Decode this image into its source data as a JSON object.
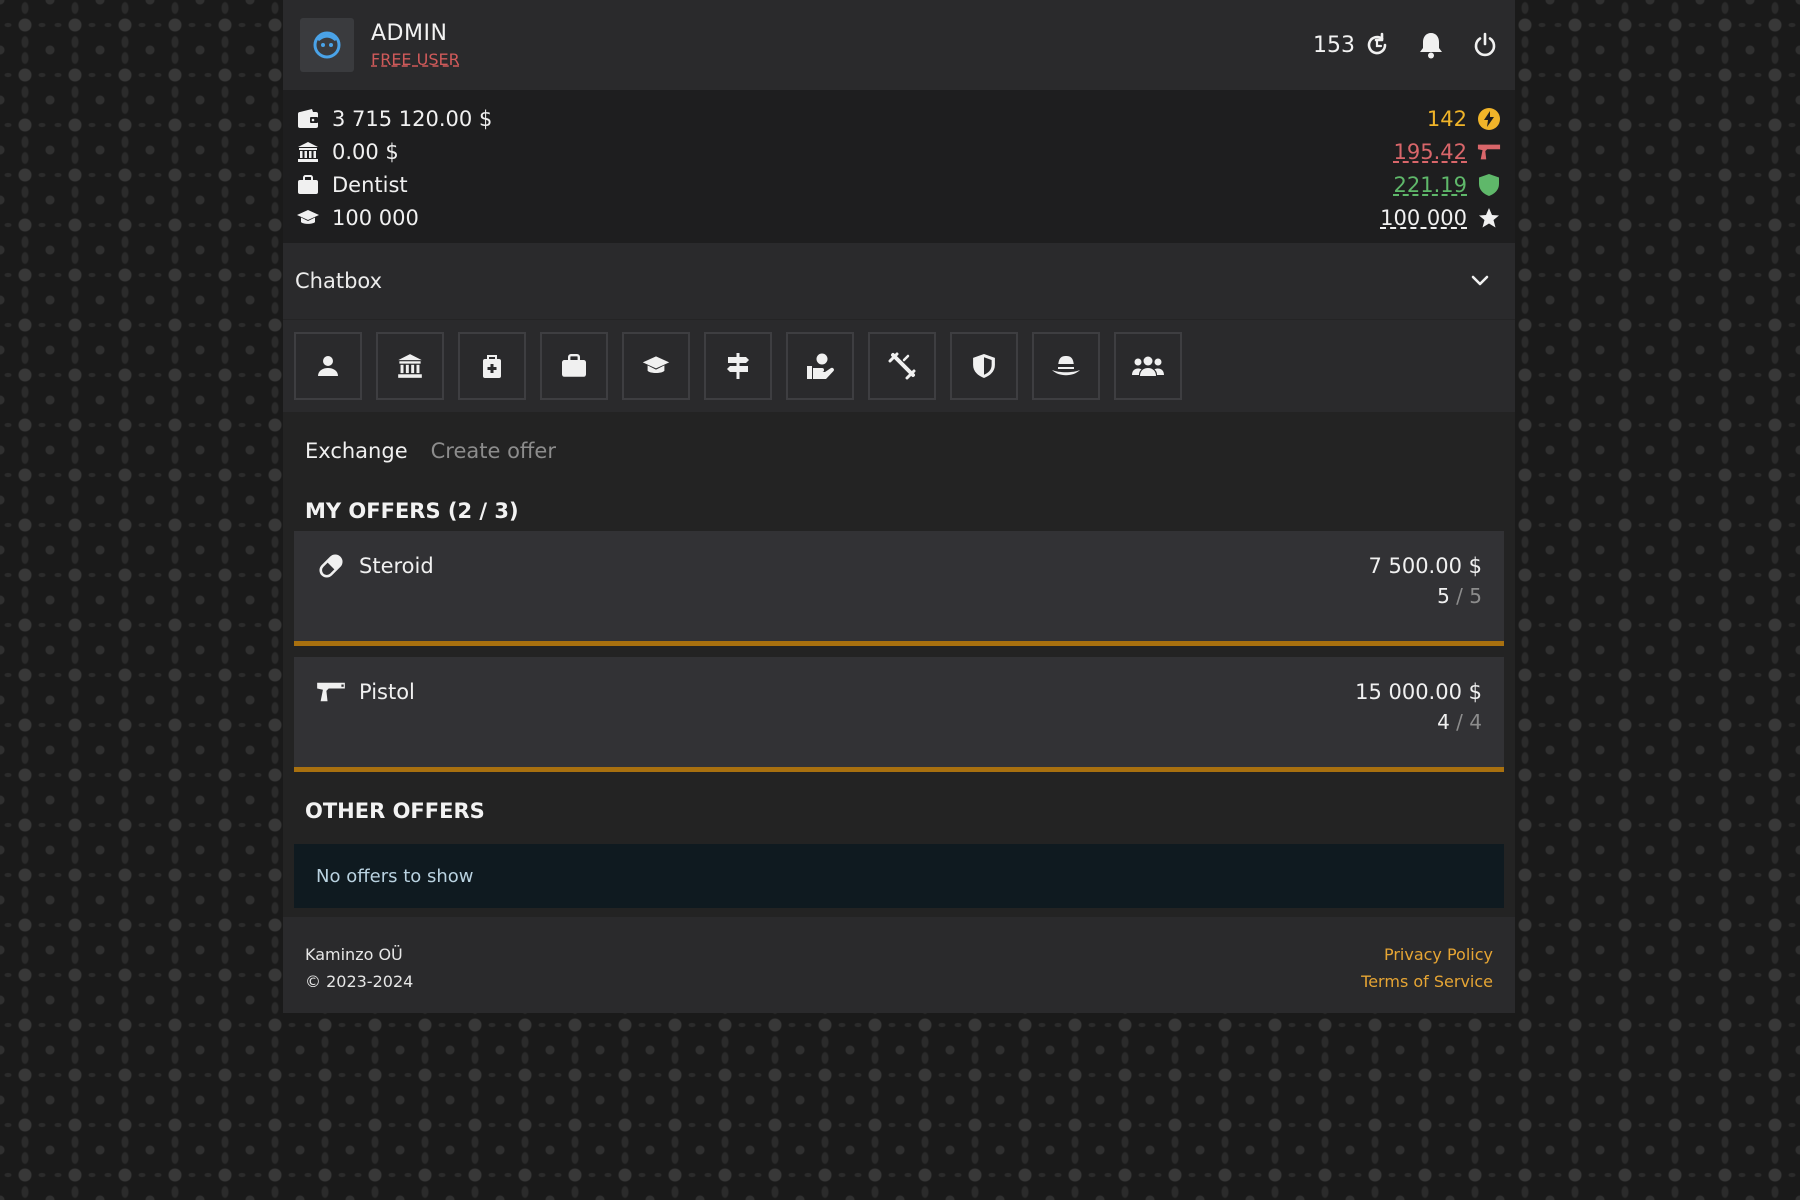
{
  "header": {
    "username": "ADMIN",
    "role": "FREE USER",
    "counter": "153"
  },
  "stats": {
    "left": {
      "cash": "3 715 120.00 $",
      "bank": "0.00 $",
      "job": "Dentist",
      "education": "100 000"
    },
    "right": {
      "energy": "142",
      "attack": "195.42",
      "defense": "221.19",
      "experience": "100 000"
    }
  },
  "chatbox": {
    "label": "Chatbox"
  },
  "nav": {
    "icons": [
      "user-icon",
      "bank-icon",
      "medkit-icon",
      "briefcase-icon",
      "graduation-cap-icon",
      "signpost-icon",
      "hand-holding-icon",
      "syringe-icon",
      "shield-icon",
      "hat-icon",
      "users-icon"
    ]
  },
  "tabs": {
    "exchange": "Exchange",
    "create_offer": "Create offer"
  },
  "my_offers": {
    "title": "MY OFFERS (2 / 3)",
    "items": [
      {
        "icon": "pill-icon",
        "name": "Steroid",
        "price": "7 500.00 $",
        "qty_have": "5",
        "qty_sep": "/",
        "qty_total": "5"
      },
      {
        "icon": "pistol-icon",
        "name": "Pistol",
        "price": "15 000.00 $",
        "qty_have": "4",
        "qty_sep": "/",
        "qty_total": "4"
      }
    ]
  },
  "other_offers": {
    "title": "OTHER OFFERS",
    "empty_text": "No offers to show"
  },
  "footer": {
    "company": "Kaminzo OÜ",
    "copyright": "© 2023-2024",
    "privacy": "Privacy Policy",
    "terms": "Terms of Service"
  },
  "colors": {
    "energy": "#f0b429",
    "attack": "#d9666a",
    "defense": "#5fb86a",
    "accent_bar": "#a8700f",
    "link": "#e6a534",
    "role": "#d05a5a"
  }
}
